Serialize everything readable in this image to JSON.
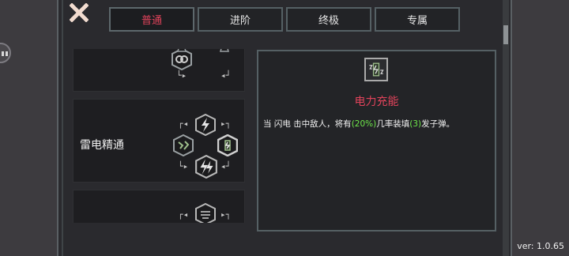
{
  "tabs": [
    {
      "label": "普通"
    },
    {
      "label": "进阶"
    },
    {
      "label": "终极"
    },
    {
      "label": "专属"
    }
  ],
  "skill_list": {
    "items": [
      {
        "title": ""
      },
      {
        "title": "雷电精通"
      },
      {
        "title": ""
      }
    ]
  },
  "detail": {
    "title": "电力充能",
    "desc_prefix": "当 闪电 击中敌人，将有",
    "chance": "(20%)",
    "desc_mid": "几率装填",
    "count": "(3)",
    "desc_suffix": "发子弹。"
  },
  "version": "ver: 1.0.65",
  "colors": {
    "accent_red": "#e2435b",
    "highlight_green": "#6ee84a",
    "panel_bg": "#2a2a2e",
    "border": "#556064"
  },
  "icons": {
    "close": "close-x-icon",
    "lightning": "lightning-icon",
    "power_charge": "power-charge-icon"
  }
}
